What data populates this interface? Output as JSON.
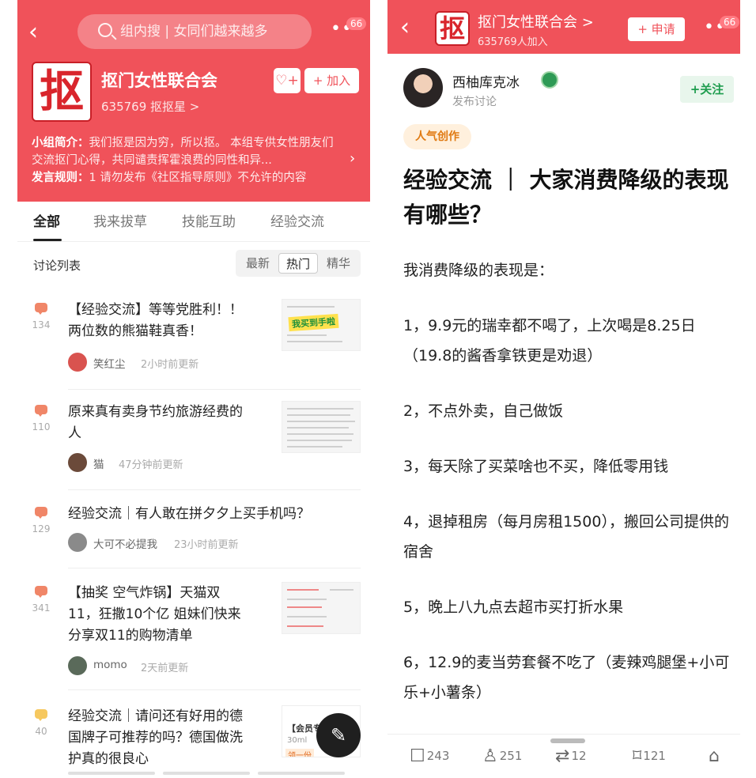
{
  "left": {
    "search_placeholder": "组内搜 | 女同们越来越多",
    "badge": "66",
    "group_name": "抠门女性联合会",
    "member_line": "635769 抠抠星 >",
    "join_label": "+ 加入",
    "heart_label": "♡+",
    "logo_char": "抠",
    "intro_label": "小组简介：",
    "intro_text": "我们抠是因为穷，所以抠。 本组专供女性朋友们交流抠门心得，共同谴责挥霍浪费的同性和异...",
    "rules_label": "发言规则：",
    "rules_text": "1 请勿发布《社区指导原则》不允许的内容",
    "tabs": [
      "全部",
      "我来拔草",
      "技能互助",
      "经验交流"
    ],
    "list_title": "讨论列表",
    "sort": [
      "最新",
      "热门",
      "精华"
    ],
    "items": [
      {
        "count": "134",
        "title_1": "【经验交流】等等党胜利！！",
        "title_2": "两位数的熊猫鞋真香！",
        "author": "笑红尘",
        "time": "2小时前更新",
        "avatar_color": "#d9534f"
      },
      {
        "count": "110",
        "title_1": "原来真有卖身节约旅游经费的",
        "title_2": "人",
        "author": "猫",
        "time": "47分钟前更新",
        "avatar_color": "#6b4a3a"
      },
      {
        "count": "129",
        "title_1": "经验交流｜有人敢在拼夕夕上买手机吗？",
        "author": "大可不必提我",
        "time": "23小时前更新",
        "avatar_color": "#8a8a8a"
      },
      {
        "count": "341",
        "title_1": "【抽奖 空气炸锅】天猫双",
        "title_2": "11，狂撒10个亿 姐妹们快来",
        "title_3": "分享双11的购物清单",
        "author": "momo",
        "time": "2天前更新",
        "avatar_color": "#5a6a5a"
      },
      {
        "count": "40",
        "title_1": "经验交流｜请问还有好用的德",
        "title_2": "国牌子可推荐的吗？德国做洗",
        "title_3": "护真的很良心"
      }
    ],
    "thumb1_text": "我买到手啦",
    "thumb5_text_1": "【会员专",
    "thumb5_text_2": "30ml",
    "thumb5_text_3": "领一份"
  },
  "right": {
    "group_name": "抠门女性联合会 >",
    "member_line": "635769人加入",
    "apply_label": "+ 申请",
    "badge": "66",
    "author": "西柚库克冰",
    "author_meta": "发布讨论",
    "follow_label": "+关注",
    "tag": "人气创作",
    "title": "经验交流 ｜ 大家消费降级的表现有哪些？",
    "lines": [
      "我消费降级的表现是：",
      "1，9.9元的瑞幸都不喝了，上次喝是8.25日（19.8的酱香拿铁更是劝退）",
      "2，不点外卖，自己做饭",
      "3，每天除了买菜啥也不买，降低零用钱",
      "4，退掉租房（每月房租1500），搬回公司提供的宿舍",
      "5，晚上八九点去超市买打折水果",
      "6，12.9的麦当劳套餐不吃了（麦辣鸡腿堡+小可乐+小薯条）"
    ],
    "actions": {
      "comments": "243",
      "likes": "251",
      "reposts": "12",
      "collects": "121"
    }
  },
  "colors": {
    "brand_red": "#f0525a",
    "follow_green": "#1f9d4f",
    "hot_orange": "#e07a12"
  }
}
